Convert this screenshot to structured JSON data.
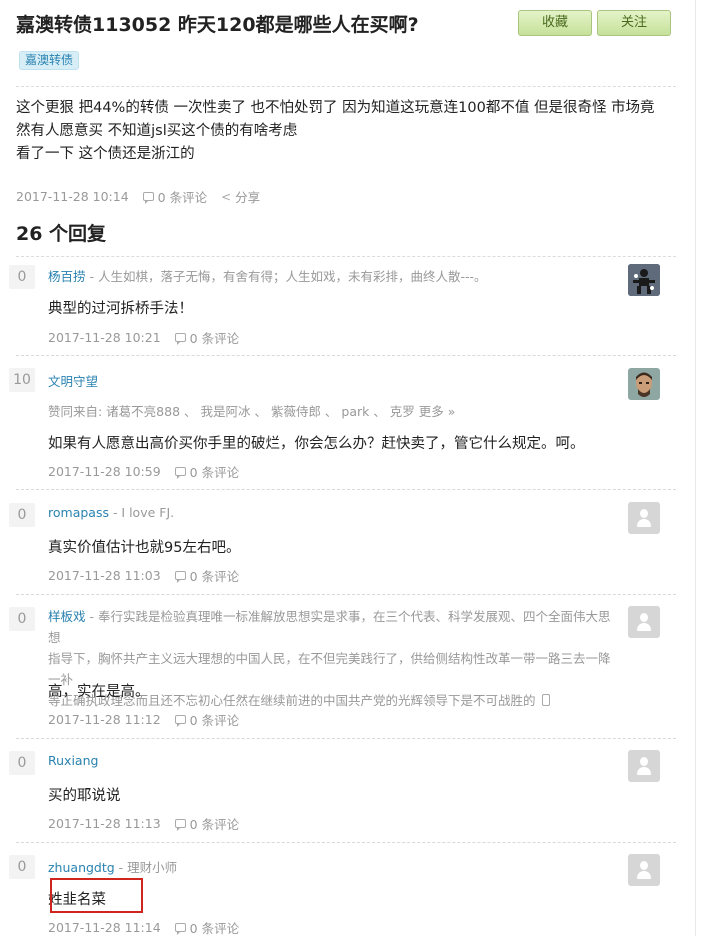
{
  "question": {
    "title": "嘉澳转债113052 昨天120都是哪些人在买啊?",
    "fav_label": "收藏",
    "follow_label": "关注",
    "topic_tag": "嘉澳转债",
    "body_lines": [
      "这个更狠 把44%的转债 一次性卖了 也不怕处罚了 因为知道这玩意连100都不值 但是很奇怪 市场竟",
      "然有人愿意买 不知道jsl买这个债的有啥考虑",
      "看了一下 这个债还是浙江的"
    ],
    "date": "2017-11-28 10:14",
    "comments": "0 条评论",
    "share": "分享"
  },
  "reply_count": "26 个回复",
  "replies": [
    {
      "votes": "0",
      "username": "杨百捞",
      "signature": " - 人生如棋，落子无悔，有舍有得；人生如戏，未有彩排，曲终人散---。",
      "content": "典型的过河拆桥手法！",
      "date": "2017-11-28 10:21",
      "comments": "0 条评论",
      "avatar": "photo-avatar"
    },
    {
      "votes": "10",
      "username": "文明守望",
      "agree": "赞同来自: 诸葛不亮888 、 我是阿冰 、 紫薇侍郎 、 park 、 克罗 更多 »",
      "content": "如果有人愿意出高价买你手里的破烂，你会怎么办？赶快卖了，管它什么规定。呵。",
      "date": "2017-11-28 10:59",
      "comments": "0 条评论",
      "avatar": "photo-avatar"
    },
    {
      "votes": "0",
      "username": "romapass",
      "signature": " - I love FJ.",
      "content": "真实价值估计也就95左右吧。",
      "date": "2017-11-28 11:03",
      "comments": "0 条评论",
      "avatar": "default-avatar"
    },
    {
      "votes": "0",
      "username": "样板戏",
      "signature_lines": [
        " - 奉行实践是检验真理唯一标准解放思想实是求事，在三个代表、科学发展观、四个全面伟大思想",
        "指导下，胸怀共产主义远大理想的中国人民，在不但完美践行了，供给侧结构性改革一带一路三去一降一补",
        "等正确执政理念而且还不忘初心任然在继续前进的中国共产党的光辉领导下是不可战胜的"
      ],
      "content": "高，实在是高。",
      "date": "2017-11-28 11:12",
      "comments": "0 条评论",
      "avatar": "default-avatar"
    },
    {
      "votes": "0",
      "username": "Ruxiang",
      "content": "买的耶说说",
      "date": "2017-11-28 11:13",
      "comments": "0 条评论",
      "avatar": "default-avatar"
    },
    {
      "votes": "0",
      "username": "zhuangdtg",
      "signature": " - 理财小师",
      "content": "姓韭名菜",
      "date": "2017-11-28 11:14",
      "comments": "0 条评论",
      "avatar": "default-avatar"
    }
  ],
  "colors": {
    "link": "#2a82b0",
    "button_bg": "#d3ebab",
    "highlight": "#d0241f"
  }
}
